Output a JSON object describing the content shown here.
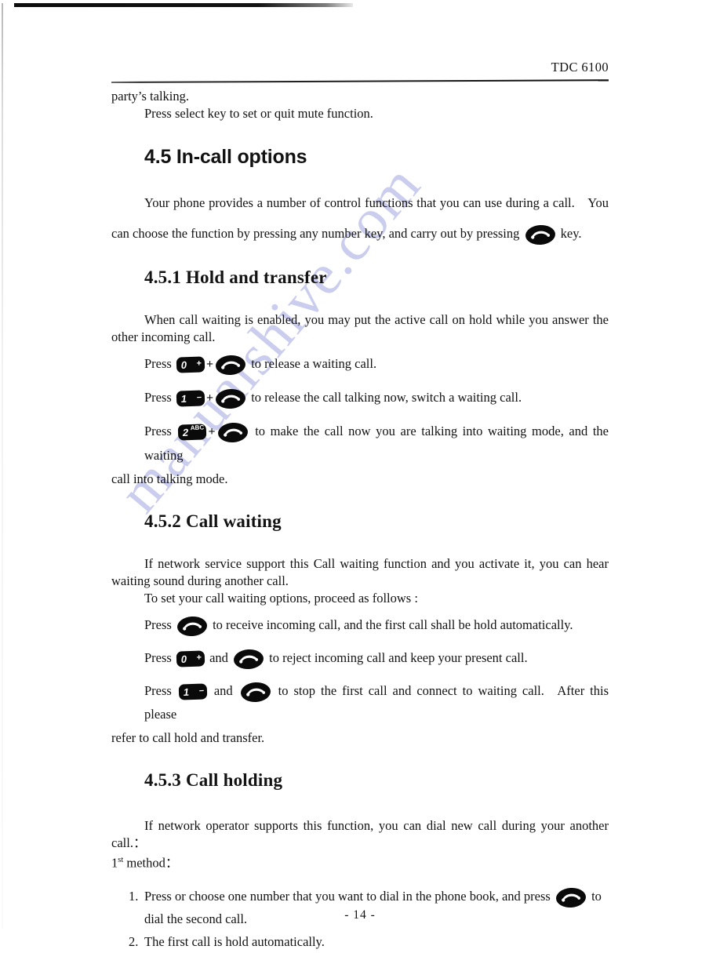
{
  "document": {
    "header_title": "TDC 6100",
    "page_number": "- 14 -",
    "watermark": "manualshive.com",
    "watermark_color": "#c6c9ec"
  },
  "body": {
    "carryover_line": "party’s talking.",
    "mute_line": "Press select key to set or quit mute function."
  },
  "section_45": {
    "heading": "4.5 In-call options",
    "intro_part1": "Your phone provides a number of control functions that you can use during a call. You can choose the function by pressing any number key, and carry out by pressing",
    "intro_part2": "key."
  },
  "section_451": {
    "heading": "4.5.1 Hold and transfer",
    "intro": "When call waiting is enabled, you may put the active call on hold while you answer the other incoming call.",
    "steps": [
      {
        "press_label": "Press",
        "key_digit": "0",
        "key_sub": "+",
        "joiner": "+",
        "tail": "to release a waiting call."
      },
      {
        "press_label": "Press",
        "key_digit": "1",
        "key_sub": "–",
        "joiner": "+",
        "tail": "to release the call talking now, switch a waiting call."
      },
      {
        "press_label": "Press",
        "key_digit": "2",
        "key_sub": "ABC",
        "joiner": "+",
        "tail": "to make the call now you are talking into waiting mode, and the waiting"
      }
    ],
    "closing": "call into talking mode."
  },
  "section_452": {
    "heading": "4.5.2 Call waiting",
    "intro": "If network service support this Call waiting function and you activate it, you can hear waiting sound during another call.",
    "lead": "To set your call waiting options, proceed as follows :",
    "steps": [
      {
        "press_label": "Press",
        "key_digit": "",
        "key_sub": "",
        "joiner": "",
        "tail": "to receive incoming call, and the first call shall be hold automatically."
      },
      {
        "press_label": "Press",
        "key_digit": "0",
        "key_sub": "+",
        "joiner": "and",
        "tail": "to reject incoming call and keep your present call."
      },
      {
        "press_label": "Press",
        "key_digit": "1",
        "key_sub": "–",
        "joiner": "and",
        "tail": "to stop the first call and connect to waiting call. After this please"
      }
    ],
    "closing": "refer to call hold and transfer."
  },
  "section_453": {
    "heading": "4.5.3 Call holding",
    "intro": "If network operator supports this function, you can dial new call during your another call.：",
    "method_prefix": "1",
    "method_sup": "st",
    "method_suffix": "method：",
    "items": [
      {
        "num": "1.",
        "text_before": "Press or choose one number that you want to dial in the phone book, and press",
        "text_after": "to",
        "continuation": "dial the second call."
      },
      {
        "num": "2.",
        "text_before": "The first call is hold automatically.",
        "text_after": "",
        "continuation": ""
      }
    ]
  },
  "icons": {
    "send_key": "phone-send-key-icon",
    "numeric_key": "numeric-keypad-key-icon"
  }
}
